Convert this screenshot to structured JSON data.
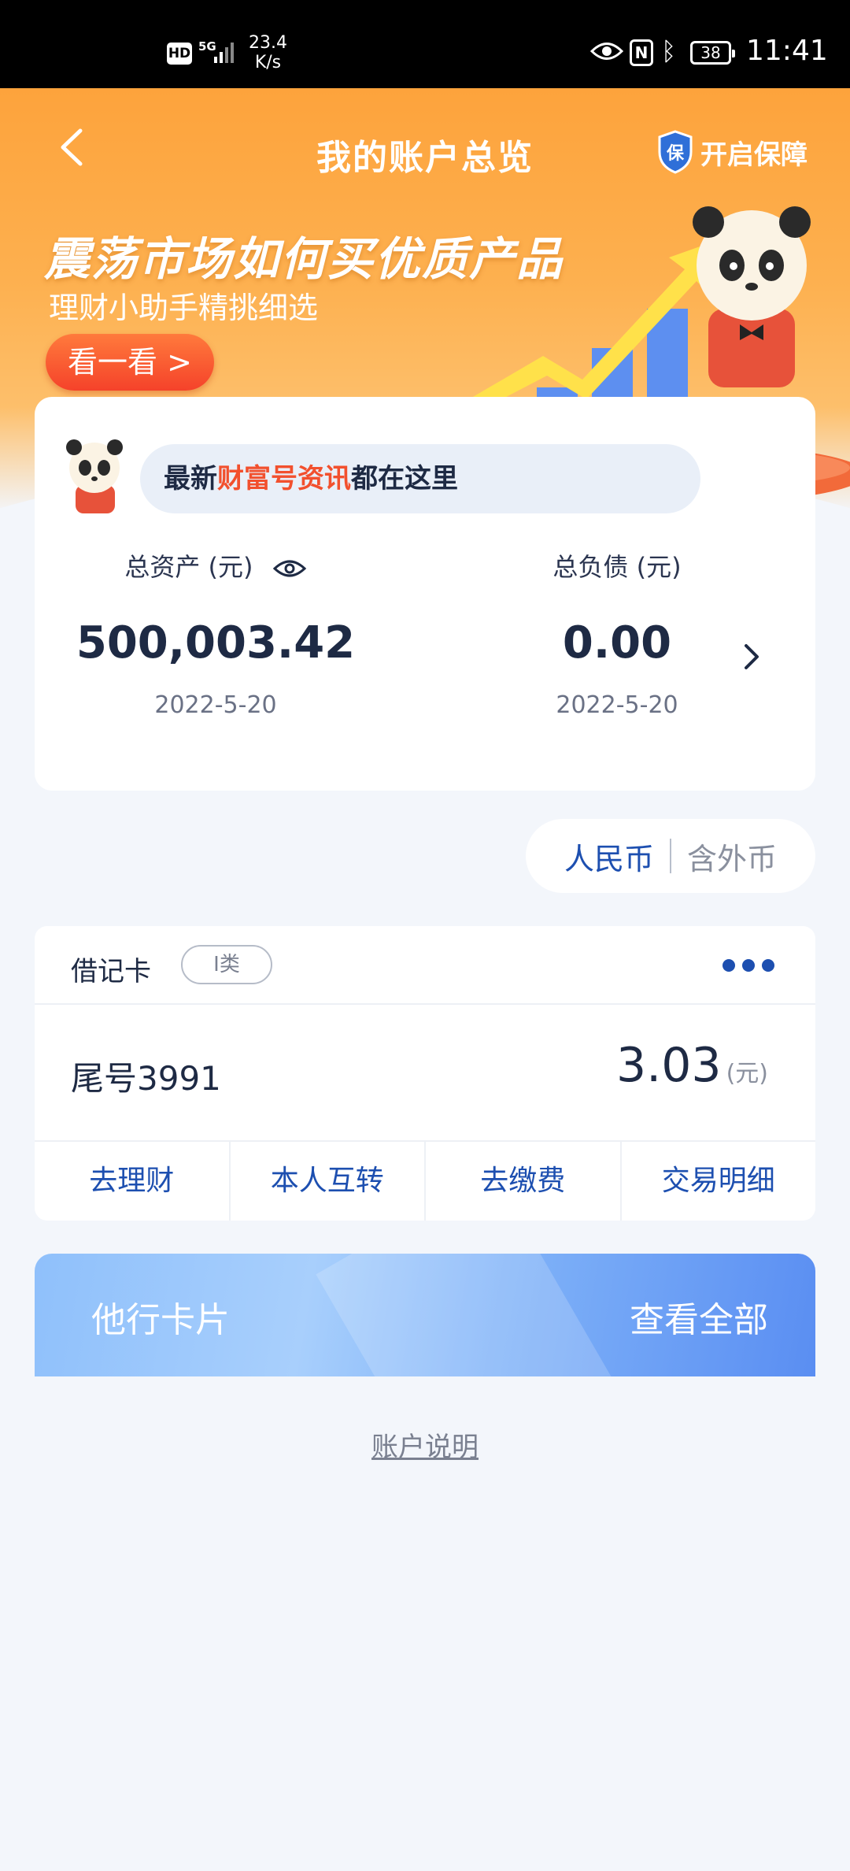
{
  "status_bar": {
    "hd": "HD",
    "network": "5G",
    "speed": "23.4\nK/s",
    "battery": "38",
    "time": "11:41"
  },
  "header": {
    "title": "我的账户总览",
    "protect_label": "开启保障",
    "shield_char": "保"
  },
  "promo": {
    "title": "震荡市场如何买优质产品",
    "subtitle": "理财小助手精挑细选",
    "button_label": "看一看 >"
  },
  "news": {
    "prefix": "最新",
    "highlight": "财富号资讯",
    "suffix": "都在这里"
  },
  "summary": {
    "assets_label": "总资产 (元)",
    "assets_value": "500,003.42",
    "assets_date": "2022-5-20",
    "debt_label": "总负债 (元)",
    "debt_value": "0.00",
    "debt_date": "2022-5-20"
  },
  "currency": {
    "rmb": "人民币",
    "fx": "含外币"
  },
  "debit_card": {
    "type": "借记卡",
    "tier": "I类",
    "tail": "尾号3991",
    "balance": "3.03",
    "unit": "(元)",
    "actions": [
      "去理财",
      "本人互转",
      "去缴费",
      "交易明细"
    ]
  },
  "other_cards": {
    "title": "他行卡片",
    "view_all": "查看全部"
  },
  "footer": {
    "account_note": "账户说明"
  },
  "colors": {
    "banner_orange": "#fda33c",
    "accent_blue": "#1d4fb0",
    "highlight_red": "#f2502e",
    "background": "#f3f6fb"
  }
}
